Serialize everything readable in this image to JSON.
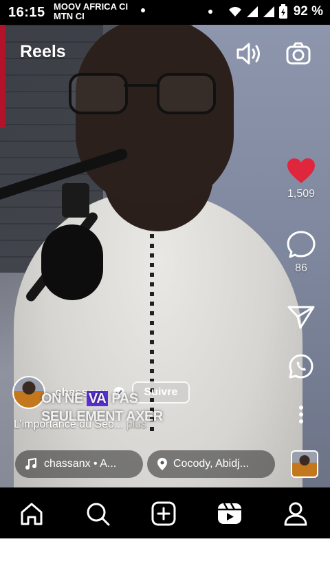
{
  "status_bar": {
    "time": "16:15",
    "carrier_line1": "MOOV AFRICA CI",
    "carrier_line2": "MTN CI",
    "battery": "92 %"
  },
  "header": {
    "title": "Reels",
    "icons": [
      "speaker-icon",
      "camera-icon"
    ]
  },
  "actions": {
    "likes": "1,509",
    "comments": "86",
    "like_color": "#e0263d"
  },
  "post": {
    "username": "chassanx",
    "follow_label": "Suivre",
    "burned_caption_line1_pre": "ON NE ",
    "burned_caption_line1_hl": "VA",
    "burned_caption_line1_post": " PAS",
    "burned_caption_line2": "SEULEMENT AXER",
    "caption": "L’importance du Seo...",
    "more_label": " plus",
    "audio": "chassanx • A...",
    "location": "Cocody, Abidj..."
  },
  "nav": {
    "items": [
      "home-icon",
      "search-icon",
      "create-icon",
      "reels-icon",
      "profile-icon"
    ]
  }
}
